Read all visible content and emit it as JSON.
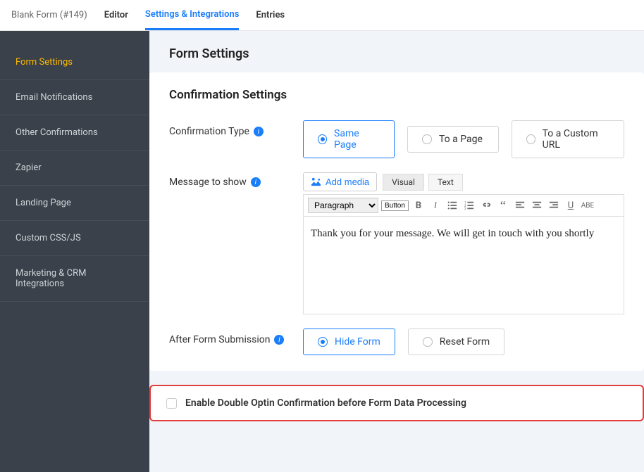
{
  "topbar": {
    "form_title": "Blank Form (#149)",
    "tabs": [
      "Editor",
      "Settings & Integrations",
      "Entries"
    ],
    "active_tab": 1
  },
  "sidebar": {
    "items": [
      "Form Settings",
      "Email Notifications",
      "Other Confirmations",
      "Zapier",
      "Landing Page",
      "Custom CSS/JS",
      "Marketing & CRM Integrations"
    ],
    "active_index": 0
  },
  "page": {
    "title": "Form Settings"
  },
  "confirmation": {
    "panel_title": "Confirmation Settings",
    "type_label": "Confirmation Type",
    "type_options": [
      "Same Page",
      "To a Page",
      "To a Custom URL"
    ],
    "type_selected": 0,
    "message_label": "Message to show",
    "add_media_label": "Add media",
    "editor_tabs": [
      "Visual",
      "Text"
    ],
    "editor_active_tab": 0,
    "paragraph_label": "Paragraph",
    "button_label": "Button",
    "message_body": "Thank you for your message. We will get in touch with you shortly",
    "after_label": "After Form Submission",
    "after_options": [
      "Hide Form",
      "Reset Form"
    ],
    "after_selected": 0
  },
  "optin": {
    "label": "Enable Double Optin Confirmation before Form Data Processing"
  }
}
